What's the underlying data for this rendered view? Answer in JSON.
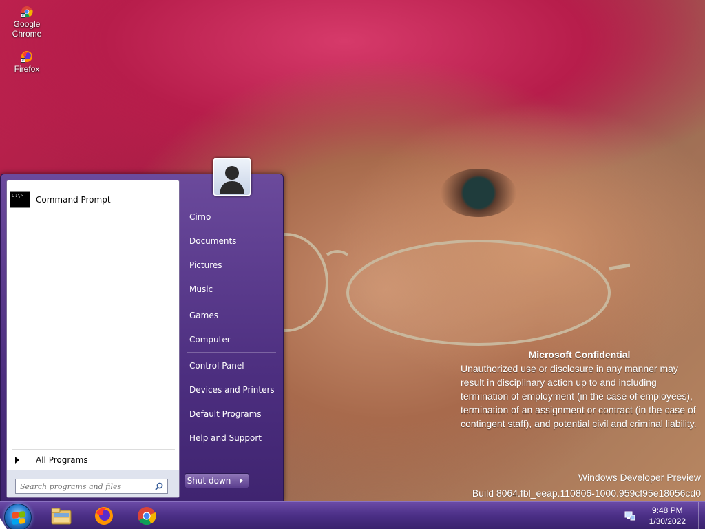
{
  "desktop": {
    "icons": [
      {
        "label": "Google Chrome",
        "icon": "chrome-icon"
      },
      {
        "label": "Firefox",
        "icon": "firefox-icon"
      }
    ]
  },
  "watermark": {
    "title": "Microsoft Confidential",
    "body": "Unauthorized use or disclosure in any manner may result in disciplinary action up to and including termination of employment (in the case of employees), termination of an assignment or contract (in the case of contingent staff), and potential civil and criminal liability.",
    "product": "Windows Developer Preview",
    "build": "Build 8064.fbl_eeap.110806-1000.959cf95e18056cd0"
  },
  "start_menu": {
    "programs": [
      {
        "label": "Command Prompt",
        "icon": "command-prompt-icon",
        "icon_text": "C:\\>_"
      }
    ],
    "all_programs": "All Programs",
    "search": {
      "placeholder": "Search programs and files",
      "value": ""
    },
    "right_items": [
      "Cirno",
      "Documents",
      "Pictures",
      "Music",
      "Games",
      "Computer",
      "Control Panel",
      "Devices and Printers",
      "Default Programs",
      "Help and Support"
    ],
    "shutdown_label": "Shut down",
    "user_icon": "user-avatar-icon"
  },
  "taskbar": {
    "pinned": [
      {
        "name": "explorer",
        "icon": "folder-icon"
      },
      {
        "name": "firefox",
        "icon": "firefox-icon"
      },
      {
        "name": "chrome",
        "icon": "chrome-icon"
      }
    ],
    "tray_icon": "network-icon",
    "time": "9:48 PM",
    "date": "1/30/2022"
  },
  "colors": {
    "taskbar": "#4b2f86",
    "start_menu": "#5a3a8e",
    "accent_blue": "#2a7fd1"
  }
}
